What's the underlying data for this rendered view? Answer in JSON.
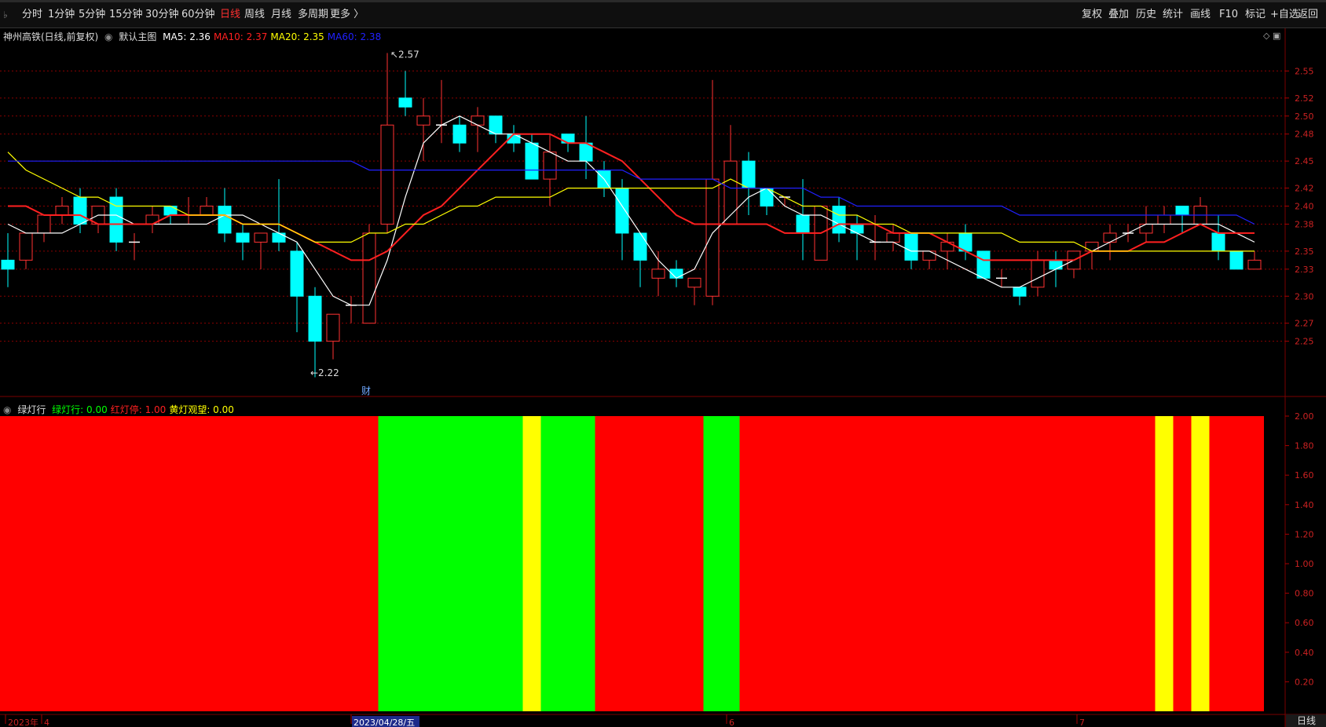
{
  "toolbar": {
    "periods": [
      {
        "label": "分时",
        "active": false
      },
      {
        "label": "1分钟",
        "active": false
      },
      {
        "label": "5分钟",
        "active": false
      },
      {
        "label": "15分钟",
        "active": false
      },
      {
        "label": "30分钟",
        "active": false
      },
      {
        "label": "60分钟",
        "active": false
      },
      {
        "label": "日线",
        "active": true
      },
      {
        "label": "周线",
        "active": false
      },
      {
        "label": "月线",
        "active": false
      },
      {
        "label": "多周期",
        "active": false
      },
      {
        "label": "更多 〉",
        "active": false
      }
    ],
    "tools": [
      "复权",
      "叠加",
      "历史",
      "统计",
      "画线",
      "F10",
      "标记",
      "+自选",
      "返回"
    ]
  },
  "main_chart": {
    "stock_name": "神州高铁(日线,前复权)",
    "indicator_name": "默认主图",
    "ma_values": [
      {
        "label": "MA5: 2.36",
        "color": "#ffffff"
      },
      {
        "label": "MA10: 2.37",
        "color": "#ff2020"
      },
      {
        "label": "MA20: 2.35",
        "color": "#ffff00"
      },
      {
        "label": "MA60: 2.38",
        "color": "#2020ff"
      }
    ],
    "high_marker": "2.57",
    "low_marker": "2.22",
    "event_marker": "财"
  },
  "lower_panel": {
    "indicator_name": "绿灯行",
    "values": [
      {
        "label": "绿灯行: 0.00",
        "color": "#00ff00"
      },
      {
        "label": "红灯停: 1.00",
        "color": "#ff2020"
      },
      {
        "label": "黄灯观望: 0.00",
        "color": "#ffff00"
      }
    ]
  },
  "colors": {
    "up": "#ff3232",
    "down": "#00ffff",
    "green": "#00ff00",
    "red": "#ff0000",
    "yellow": "#ffff00",
    "grid": "#8a0000",
    "axis_text": "#cc2222"
  },
  "chart_data": [
    {
      "type": "candlestick",
      "title": "神州高铁(日线,前复权)",
      "ylim": [
        2.2,
        2.58
      ],
      "y_ticks": [
        "2.55",
        "2.52",
        "2.50",
        "2.48",
        "2.45",
        "2.42",
        "2.40",
        "2.38",
        "2.35",
        "2.33",
        "2.30",
        "2.27",
        "2.25"
      ],
      "x_tick_labels": [
        "2023年",
        "4",
        "2023/04/28/五",
        "6",
        "7"
      ],
      "candles": [
        [
          2.34,
          2.37,
          2.31,
          2.33
        ],
        [
          2.34,
          2.36,
          2.33,
          2.37
        ],
        [
          2.37,
          2.39,
          2.36,
          2.39
        ],
        [
          2.39,
          2.41,
          2.38,
          2.4
        ],
        [
          2.41,
          2.42,
          2.37,
          2.38
        ],
        [
          2.38,
          2.39,
          2.37,
          2.4
        ],
        [
          2.41,
          2.42,
          2.35,
          2.36
        ],
        [
          2.36,
          2.37,
          2.34,
          2.36
        ],
        [
          2.38,
          2.4,
          2.37,
          2.39
        ],
        [
          2.4,
          2.4,
          2.38,
          2.39
        ],
        [
          2.39,
          2.41,
          2.38,
          2.39
        ],
        [
          2.39,
          2.41,
          2.39,
          2.4
        ],
        [
          2.4,
          2.42,
          2.36,
          2.37
        ],
        [
          2.37,
          2.38,
          2.34,
          2.36
        ],
        [
          2.36,
          2.37,
          2.33,
          2.37
        ],
        [
          2.37,
          2.43,
          2.35,
          2.36
        ],
        [
          2.35,
          2.36,
          2.26,
          2.3
        ],
        [
          2.3,
          2.31,
          2.21,
          2.25
        ],
        [
          2.25,
          2.28,
          2.23,
          2.28
        ],
        [
          2.29,
          2.3,
          2.27,
          2.29
        ],
        [
          2.27,
          2.38,
          2.27,
          2.37
        ],
        [
          2.38,
          2.57,
          2.37,
          2.49
        ],
        [
          2.52,
          2.55,
          2.5,
          2.51
        ],
        [
          2.49,
          2.52,
          2.45,
          2.5
        ],
        [
          2.49,
          2.54,
          2.47,
          2.49
        ],
        [
          2.49,
          2.5,
          2.46,
          2.47
        ],
        [
          2.49,
          2.51,
          2.46,
          2.5
        ],
        [
          2.5,
          2.5,
          2.47,
          2.48
        ],
        [
          2.48,
          2.49,
          2.46,
          2.47
        ],
        [
          2.47,
          2.48,
          2.44,
          2.43
        ],
        [
          2.43,
          2.48,
          2.4,
          2.46
        ],
        [
          2.48,
          2.48,
          2.46,
          2.47
        ],
        [
          2.47,
          2.5,
          2.43,
          2.45
        ],
        [
          2.44,
          2.45,
          2.41,
          2.42
        ],
        [
          2.42,
          2.43,
          2.34,
          2.37
        ],
        [
          2.37,
          2.37,
          2.31,
          2.34
        ],
        [
          2.32,
          2.35,
          2.3,
          2.33
        ],
        [
          2.33,
          2.34,
          2.31,
          2.32
        ],
        [
          2.31,
          2.32,
          2.29,
          2.32
        ],
        [
          2.3,
          2.54,
          2.29,
          2.43
        ],
        [
          2.38,
          2.49,
          2.38,
          2.45
        ],
        [
          2.45,
          2.46,
          2.39,
          2.42
        ],
        [
          2.42,
          2.42,
          2.39,
          2.4
        ],
        [
          2.41,
          2.41,
          2.4,
          2.41
        ],
        [
          2.39,
          2.43,
          2.34,
          2.37
        ],
        [
          2.34,
          2.39,
          2.34,
          2.4
        ],
        [
          2.4,
          2.41,
          2.36,
          2.37
        ],
        [
          2.38,
          2.39,
          2.34,
          2.37
        ],
        [
          2.36,
          2.39,
          2.34,
          2.36
        ],
        [
          2.36,
          2.38,
          2.35,
          2.37
        ],
        [
          2.37,
          2.37,
          2.33,
          2.34
        ],
        [
          2.34,
          2.35,
          2.33,
          2.35
        ],
        [
          2.35,
          2.37,
          2.33,
          2.36
        ],
        [
          2.37,
          2.38,
          2.34,
          2.35
        ],
        [
          2.35,
          2.35,
          2.32,
          2.32
        ],
        [
          2.32,
          2.33,
          2.31,
          2.32
        ],
        [
          2.31,
          2.31,
          2.29,
          2.3
        ],
        [
          2.31,
          2.35,
          2.3,
          2.34
        ],
        [
          2.34,
          2.35,
          2.31,
          2.33
        ],
        [
          2.33,
          2.35,
          2.32,
          2.35
        ],
        [
          2.35,
          2.36,
          2.33,
          2.36
        ],
        [
          2.36,
          2.38,
          2.34,
          2.37
        ],
        [
          2.37,
          2.38,
          2.36,
          2.37
        ],
        [
          2.37,
          2.4,
          2.36,
          2.38
        ],
        [
          2.38,
          2.4,
          2.37,
          2.39
        ],
        [
          2.4,
          2.4,
          2.37,
          2.39
        ],
        [
          2.38,
          2.41,
          2.38,
          2.4
        ],
        [
          2.37,
          2.39,
          2.34,
          2.35
        ],
        [
          2.35,
          2.35,
          2.33,
          2.33
        ],
        [
          2.33,
          2.35,
          2.33,
          2.34
        ]
      ],
      "series": [
        {
          "name": "MA5",
          "color": "#ffffff",
          "values": [
            2.38,
            2.37,
            2.37,
            2.37,
            2.38,
            2.39,
            2.39,
            2.38,
            2.38,
            2.38,
            2.38,
            2.38,
            2.39,
            2.39,
            2.38,
            2.37,
            2.36,
            2.33,
            2.3,
            2.29,
            2.29,
            2.34,
            2.41,
            2.47,
            2.49,
            2.5,
            2.49,
            2.48,
            2.48,
            2.47,
            2.46,
            2.45,
            2.45,
            2.43,
            2.4,
            2.37,
            2.34,
            2.32,
            2.33,
            2.37,
            2.39,
            2.41,
            2.42,
            2.4,
            2.39,
            2.39,
            2.38,
            2.37,
            2.36,
            2.36,
            2.35,
            2.35,
            2.34,
            2.33,
            2.32,
            2.31,
            2.31,
            2.32,
            2.33,
            2.34,
            2.35,
            2.36,
            2.37,
            2.38,
            2.38,
            2.38,
            2.38,
            2.38,
            2.37,
            2.36
          ]
        },
        {
          "name": "MA10",
          "color": "#ff2020",
          "values": [
            2.4,
            2.4,
            2.39,
            2.39,
            2.39,
            2.38,
            2.38,
            2.38,
            2.38,
            2.39,
            2.39,
            2.39,
            2.39,
            2.38,
            2.38,
            2.38,
            2.37,
            2.36,
            2.35,
            2.34,
            2.34,
            2.35,
            2.37,
            2.39,
            2.4,
            2.42,
            2.44,
            2.46,
            2.48,
            2.48,
            2.48,
            2.47,
            2.47,
            2.46,
            2.45,
            2.43,
            2.41,
            2.39,
            2.38,
            2.38,
            2.38,
            2.38,
            2.38,
            2.37,
            2.37,
            2.37,
            2.38,
            2.38,
            2.38,
            2.37,
            2.37,
            2.37,
            2.36,
            2.35,
            2.34,
            2.34,
            2.34,
            2.34,
            2.34,
            2.34,
            2.35,
            2.35,
            2.35,
            2.36,
            2.36,
            2.37,
            2.38,
            2.37,
            2.37,
            2.37
          ]
        },
        {
          "name": "MA20",
          "color": "#ffff00",
          "values": [
            2.46,
            2.44,
            2.43,
            2.42,
            2.41,
            2.41,
            2.4,
            2.4,
            2.4,
            2.4,
            2.39,
            2.39,
            2.39,
            2.38,
            2.38,
            2.38,
            2.37,
            2.36,
            2.36,
            2.36,
            2.37,
            2.37,
            2.38,
            2.38,
            2.39,
            2.4,
            2.4,
            2.41,
            2.41,
            2.41,
            2.41,
            2.42,
            2.42,
            2.42,
            2.42,
            2.42,
            2.42,
            2.42,
            2.42,
            2.42,
            2.43,
            2.42,
            2.42,
            2.41,
            2.4,
            2.4,
            2.39,
            2.39,
            2.38,
            2.38,
            2.37,
            2.37,
            2.37,
            2.37,
            2.37,
            2.37,
            2.36,
            2.36,
            2.36,
            2.36,
            2.35,
            2.35,
            2.35,
            2.35,
            2.35,
            2.35,
            2.35,
            2.35,
            2.35,
            2.35
          ]
        },
        {
          "name": "MA60",
          "color": "#2020ff",
          "values": [
            2.45,
            2.45,
            2.45,
            2.45,
            2.45,
            2.45,
            2.45,
            2.45,
            2.45,
            2.45,
            2.45,
            2.45,
            2.45,
            2.45,
            2.45,
            2.45,
            2.45,
            2.45,
            2.45,
            2.45,
            2.44,
            2.44,
            2.44,
            2.44,
            2.44,
            2.44,
            2.44,
            2.44,
            2.44,
            2.44,
            2.44,
            2.44,
            2.44,
            2.44,
            2.44,
            2.43,
            2.43,
            2.43,
            2.43,
            2.43,
            2.42,
            2.42,
            2.42,
            2.42,
            2.42,
            2.41,
            2.41,
            2.4,
            2.4,
            2.4,
            2.4,
            2.4,
            2.4,
            2.4,
            2.4,
            2.4,
            2.39,
            2.39,
            2.39,
            2.39,
            2.39,
            2.39,
            2.39,
            2.39,
            2.39,
            2.39,
            2.39,
            2.39,
            2.39,
            2.38
          ]
        }
      ]
    },
    {
      "type": "bar",
      "title": "绿灯行",
      "ylim": [
        0,
        2.0
      ],
      "y_ticks": [
        "2.00",
        "1.80",
        "1.60",
        "1.40",
        "1.20",
        "1.00",
        "0.80",
        "0.60",
        "0.40",
        "0.20"
      ],
      "signal": [
        "R",
        "R",
        "R",
        "R",
        "R",
        "R",
        "R",
        "R",
        "R",
        "R",
        "R",
        "R",
        "R",
        "R",
        "R",
        "R",
        "R",
        "R",
        "R",
        "R",
        "R",
        "G",
        "G",
        "G",
        "G",
        "G",
        "G",
        "G",
        "G",
        "Y",
        "G",
        "G",
        "G",
        "R",
        "R",
        "R",
        "R",
        "R",
        "R",
        "G",
        "G",
        "R",
        "R",
        "R",
        "R",
        "R",
        "R",
        "R",
        "R",
        "R",
        "R",
        "R",
        "R",
        "R",
        "R",
        "R",
        "R",
        "R",
        "R",
        "R",
        "R",
        "R",
        "R",
        "R",
        "Y",
        "R",
        "Y",
        "R",
        "R",
        "R"
      ]
    }
  ]
}
